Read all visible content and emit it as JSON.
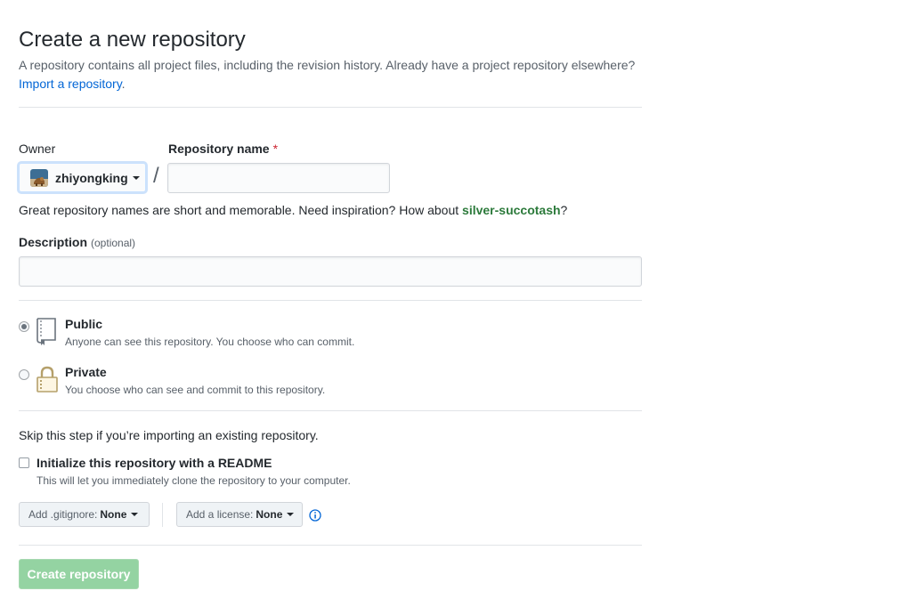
{
  "header": {
    "title": "Create a new repository",
    "subtitle": "A repository contains all project files, including the revision history. Already have a project repository elsewhere?",
    "import_link": "Import a repository",
    "import_suffix": "."
  },
  "owner": {
    "label": "Owner",
    "value": "zhiyongking",
    "avatar_icon": "user-avatar"
  },
  "separator": "/",
  "repo_name": {
    "label": "Repository name",
    "required_mark": "*",
    "value": "",
    "placeholder": ""
  },
  "name_hint": {
    "text": "Great repository names are short and memorable. Need inspiration? How about ",
    "suggestion": "silver-succotash",
    "suffix": "?"
  },
  "description": {
    "label": "Description",
    "optional": "(optional)",
    "value": "",
    "placeholder": ""
  },
  "visibility": {
    "selected": "public",
    "options": [
      {
        "id": "public",
        "title": "Public",
        "note": "Anyone can see this repository. You choose who can commit.",
        "icon": "repo-book-icon"
      },
      {
        "id": "private",
        "title": "Private",
        "note": "You choose who can see and commit to this repository.",
        "icon": "lock-icon"
      }
    ]
  },
  "init": {
    "skip_text": "Skip this step if you’re importing an existing repository.",
    "readme_label": "Initialize this repository with a README",
    "readme_note": "This will let you immediately clone the repository to your computer.",
    "readme_checked": false
  },
  "gitignore": {
    "label": "Add .gitignore:",
    "value": "None"
  },
  "license": {
    "label": "Add a license:",
    "value": "None"
  },
  "submit_label": "Create repository",
  "colors": {
    "link": "#0366d6",
    "suggestion": "#2c7a3b",
    "required": "#cb2431",
    "submit_disabled": "#94d3a2"
  }
}
